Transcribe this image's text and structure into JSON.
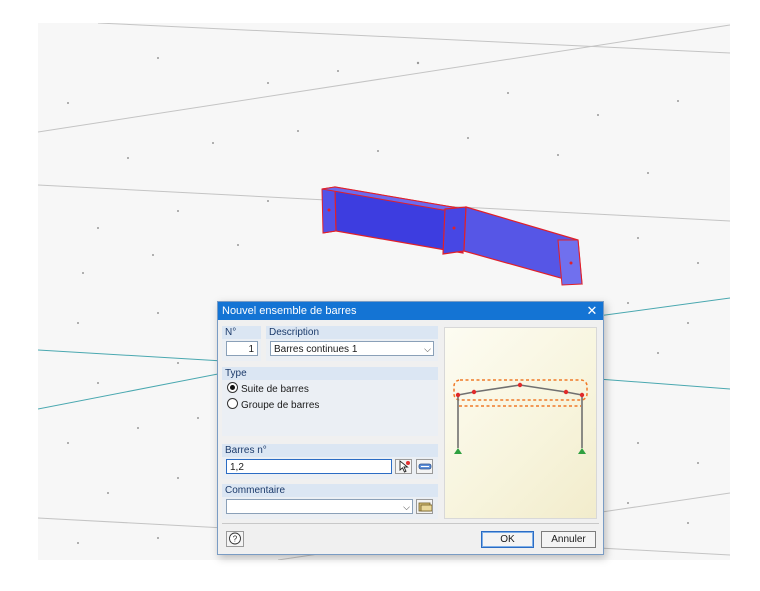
{
  "dialog": {
    "title": "Nouvel ensemble de barres",
    "number": {
      "label": "N°",
      "value": "1"
    },
    "description": {
      "label": "Description",
      "value": "Barres continues 1"
    },
    "type": {
      "label": "Type",
      "options": [
        {
          "label": "Suite de barres",
          "checked": true
        },
        {
          "label": "Groupe de barres",
          "checked": false
        }
      ]
    },
    "members": {
      "label": "Barres n°",
      "value": "1,2"
    },
    "comment": {
      "label": "Commentaire",
      "value": ""
    },
    "buttons": {
      "ok": "OK",
      "cancel": "Annuler"
    }
  },
  "colors": {
    "titlebar": "#1474d4",
    "member_fill": "#3d3de0",
    "member_outline": "#e0202a",
    "grid_line": "#bdbdbd",
    "support_line": "#4aa8b0",
    "preview_frame": "#707070",
    "preview_node": "#e02a2a",
    "preview_support": "#2fa040",
    "preview_highlight": "#f07a28"
  },
  "icons": {
    "close": "close-icon",
    "pick": "pick-from-model-icon",
    "member_list": "member-list-icon",
    "comment_library": "comment-library-icon",
    "help": "help-icon"
  }
}
